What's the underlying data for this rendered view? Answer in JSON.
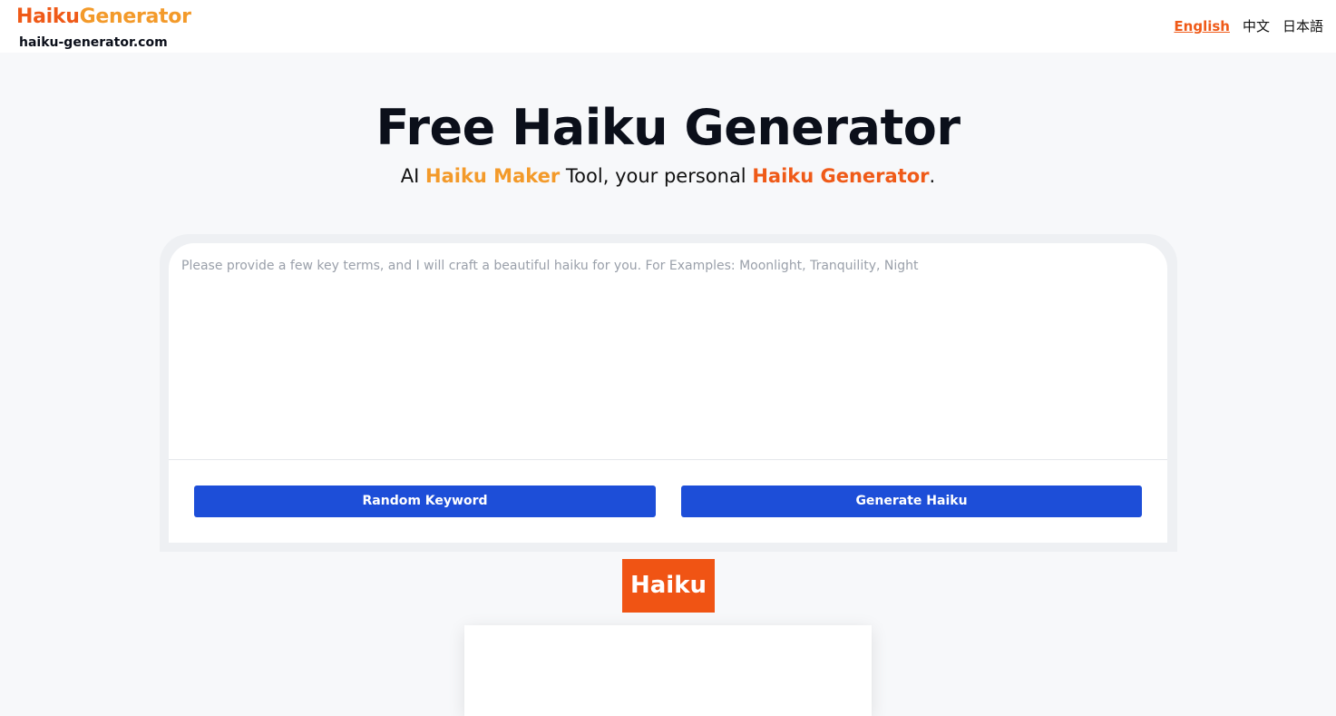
{
  "header": {
    "brand_part_1": "Haiku",
    "brand_part_2": "Generator",
    "domain": "haiku-generator.com",
    "languages": [
      {
        "label": "English",
        "active": true
      },
      {
        "label": "中文",
        "active": false
      },
      {
        "label": "日本語",
        "active": false
      }
    ]
  },
  "hero": {
    "title": "Free Haiku Generator",
    "subtitle": {
      "part_1": "AI ",
      "highlight_1": "Haiku Maker",
      "part_2": " Tool, your personal ",
      "highlight_2": "Haiku Generator",
      "part_3": "."
    }
  },
  "input_card": {
    "keyword_value": "",
    "keyword_placeholder": "Please provide a few key terms, and I will craft a beautiful haiku for you. For Examples: Moonlight, Tranquility, Night",
    "random_button_label": "Random Keyword",
    "generate_button_label": "Generate Haiku"
  },
  "output": {
    "label": "Haiku",
    "text": ""
  },
  "colors": {
    "brand_orange": "#ef5a18",
    "brand_amber": "#f39a2a",
    "button_blue": "#1d4ed8",
    "haiku_label_bg": "#f05414"
  }
}
